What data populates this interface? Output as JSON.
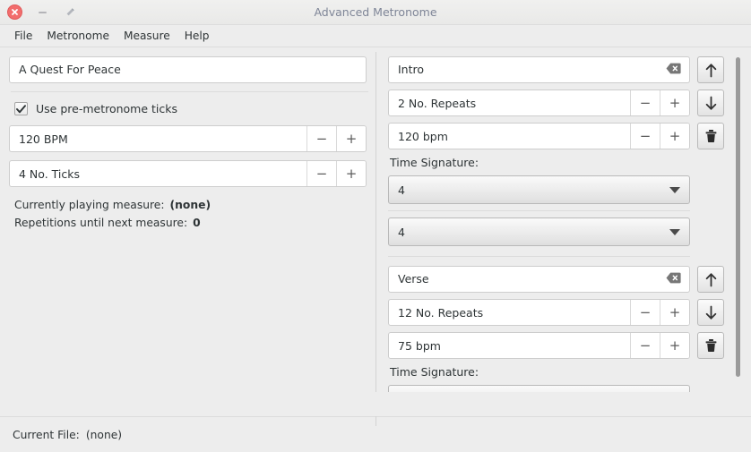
{
  "window": {
    "title": "Advanced Metronome",
    "controls": {
      "close": "close-button",
      "minimize": "minimize-button",
      "maximize": "maximize-button"
    }
  },
  "menubar": {
    "items": [
      {
        "label": "File"
      },
      {
        "label": "Metronome"
      },
      {
        "label": "Measure"
      },
      {
        "label": "Help"
      }
    ]
  },
  "left": {
    "song_title": {
      "value": "A Quest For Peace",
      "placeholder": ""
    },
    "pre_ticks": {
      "label": "Use pre-metronome ticks",
      "checked": true
    },
    "bpm": {
      "value": "120 BPM",
      "minus": "−",
      "plus": "+"
    },
    "ticks": {
      "value": "4 No. Ticks",
      "minus": "−",
      "plus": "+"
    },
    "status": [
      {
        "label": "Currently playing measure:",
        "value": "(none)"
      },
      {
        "label": "Repetitions until next measure:",
        "value": "0"
      }
    ]
  },
  "statusbar": {
    "label": "Current File:",
    "value": "(none)"
  },
  "right": {
    "time_signature_label": "Time Signature:",
    "measures": [
      {
        "name": {
          "value": "Intro",
          "clear_icon": "clear-text-icon"
        },
        "repeats": {
          "value": "2 No. Repeats",
          "minus": "−",
          "plus": "+"
        },
        "tempo": {
          "value": "120 bpm",
          "minus": "−",
          "plus": "+"
        },
        "move_up": "move-up-icon",
        "move_down": "move-down-icon",
        "delete": "trash-icon",
        "time_signature_label": "Time Signature:",
        "beats": "4",
        "note_value": "4"
      },
      {
        "name": {
          "value": "Verse",
          "clear_icon": "clear-text-icon"
        },
        "repeats": {
          "value": "12 No. Repeats",
          "minus": "−",
          "plus": "+"
        },
        "tempo": {
          "value": "75 bpm",
          "minus": "−",
          "plus": "+"
        },
        "move_up": "move-up-icon",
        "move_down": "move-down-icon",
        "delete": "trash-icon",
        "time_signature_label": "Time Signature:",
        "beats": "",
        "note_value": ""
      }
    ]
  },
  "colors": {
    "window_bg": "#ededed",
    "entry_bg": "#ffffff",
    "title_text": "#7e8597",
    "close_red": "#f26d6d",
    "scrollbar": "#9a9a9a"
  }
}
